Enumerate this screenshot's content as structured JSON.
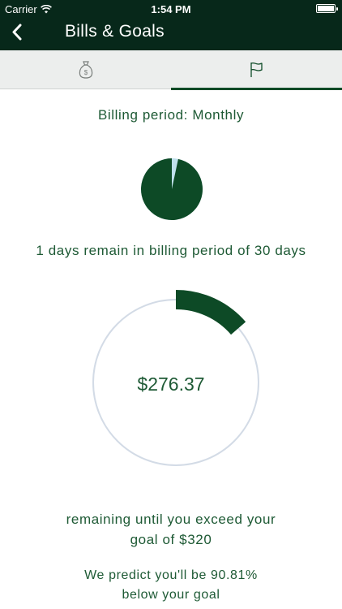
{
  "status_bar": {
    "carrier": "Carrier",
    "time": "1:54 PM",
    "wifi_icon": "wifi-icon",
    "battery_icon": "battery-icon",
    "battery_level": 1.0
  },
  "nav": {
    "title": "Bills & Goals",
    "back_icon": "chevron-left-icon"
  },
  "tabs": [
    {
      "icon": "money-bag-icon",
      "selected": false
    },
    {
      "icon": "flag-icon",
      "selected": true
    }
  ],
  "billing_period_label": "Billing period: Monthly",
  "billing_pie": {
    "elapsed_fraction": 0.9667,
    "remaining_fraction": 0.0333
  },
  "days_text": "1 days remain in billing period of 30 days",
  "gauge": {
    "amount": "$276.37",
    "arc_fraction": 0.1364
  },
  "remaining_text_line1": "remaining until you exceed your",
  "remaining_text_line2": "goal of $320",
  "predict_line1": "We predict you'll be 90.81%",
  "predict_line2": "below your goal",
  "colors": {
    "header_bg": "#07281a",
    "accent": "#0d4a26",
    "pie_remaining": "#bfe0ec",
    "gauge_track": "#d3dbe6",
    "tab_bg": "#eceeed"
  }
}
